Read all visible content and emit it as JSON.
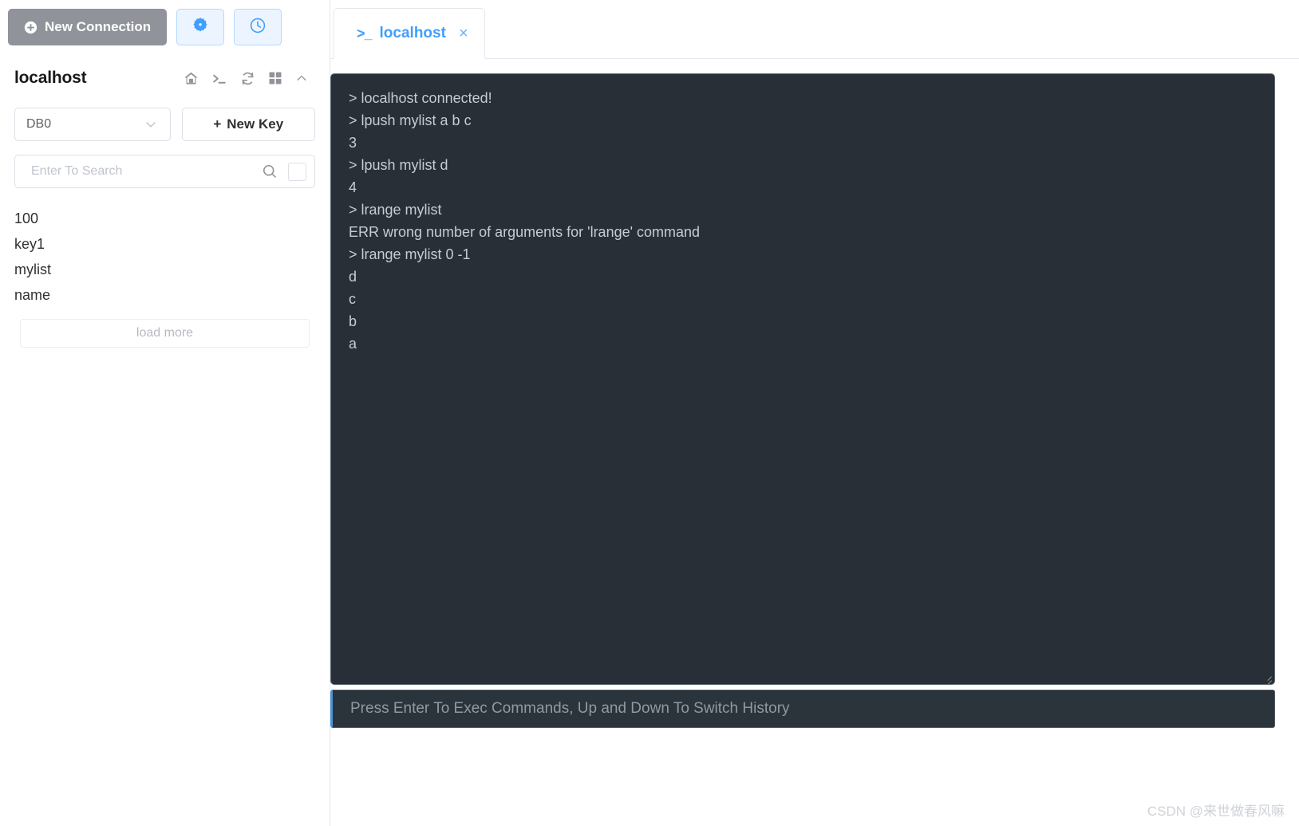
{
  "toolbar": {
    "new_connection_label": "New Connection",
    "settings_icon": "gear-icon",
    "history_icon": "clock-icon"
  },
  "sidebar": {
    "connection_name": "localhost",
    "header_icons": [
      "home-icon",
      "terminal-icon",
      "refresh-icon",
      "grid-icon",
      "chevron-up-icon"
    ],
    "db_select": {
      "value": "DB0",
      "options": [
        "DB0"
      ]
    },
    "new_key_label": "New Key",
    "new_key_plus": "+",
    "search": {
      "placeholder": "Enter To Search",
      "value": ""
    },
    "keys": [
      "100",
      "key1",
      "mylist",
      "name"
    ],
    "load_more_label": "load more"
  },
  "tabs": [
    {
      "glyph": ">_",
      "label": "localhost",
      "close": "×",
      "active": true
    }
  ],
  "terminal": {
    "lines": [
      "> localhost connected!",
      "> lpush mylist a b c",
      "3",
      "> lpush mylist d",
      "4",
      "> lrange mylist",
      "ERR wrong number of arguments for 'lrange' command",
      "> lrange mylist 0 -1",
      "d",
      "c",
      "b",
      "a"
    ],
    "input": {
      "placeholder": "Press Enter To Exec Commands, Up and Down To Switch History",
      "value": ""
    }
  },
  "watermark": "CSDN @来世做春风嘛",
  "colors": {
    "accent": "#409eff",
    "accent_soft_bg": "#ecf5ff",
    "accent_soft_border": "#b3d8ff",
    "button_gray": "#909399",
    "terminal_bg": "#282f36",
    "terminal_text": "#c5ccd3",
    "terminal_input_bg": "#2b333b",
    "terminal_input_accent": "#4e93d6",
    "border": "#dcdfe6"
  }
}
